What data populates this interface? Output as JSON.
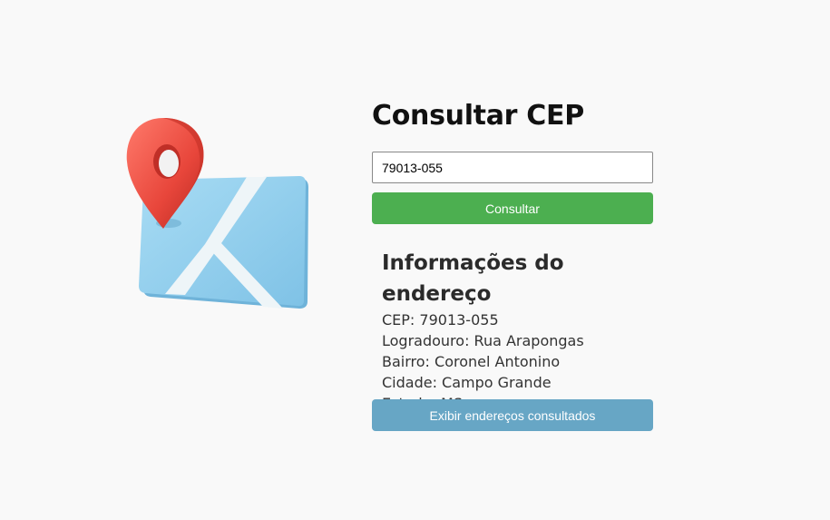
{
  "illustration": {
    "icon": "map-location-pin-icon",
    "pin_color": "#e9473c",
    "map_color": "#8fcdee"
  },
  "form": {
    "title": "Consultar CEP",
    "cep_value": "79013-055",
    "submit_label": "Consultar",
    "submit_color": "#4caf50"
  },
  "address": {
    "heading": "Informações do endereço",
    "lines": [
      "CEP: 79013-055",
      "Logradouro: Rua Arapongas",
      "Bairro: Coronel Antonino",
      "Cidade: Campo Grande",
      "Estado: MS"
    ]
  },
  "history": {
    "button_label": "Exibir endereços consultados",
    "button_color": "#67a6c5"
  }
}
